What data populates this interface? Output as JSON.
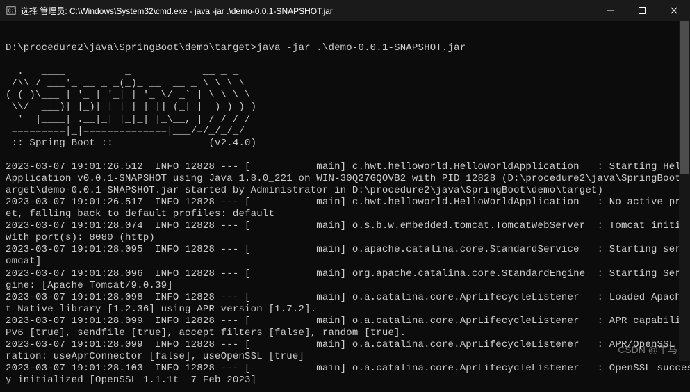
{
  "window": {
    "title": "选择 管理员: C:\\Windows\\System32\\cmd.exe - java  -jar .\\demo-0.0.1-SNAPSHOT.jar"
  },
  "terminal": {
    "prompt_line": "D:\\procedure2\\java\\SpringBoot\\demo\\target>java -jar .\\demo-0.0.1-SNAPSHOT.jar",
    "banner": "  .   ____          _            __ _ _\n /\\\\ / ___'_ __ _ _(_)_ __  __ _ \\ \\ \\ \\\n( ( )\\___ | '_ | '_| | '_ \\/ _` | \\ \\ \\ \\\n \\\\/  ___)| |_)| | | | | || (_| |  ) ) ) )\n  '  |____| .__|_| |_|_| |_\\__, | / / / /\n =========|_|==============|___/=/_/_/_/",
    "banner_footer": " :: Spring Boot ::                (v2.4.0)",
    "log_block": "2023-03-07 19:01:26.512  INFO 12828 --- [           main] c.hwt.helloworld.HelloWorldApplication   : Starting HelloWorld\nApplication v0.0.1-SNAPSHOT using Java 1.8.0_221 on WIN-30Q27GQOVB2 with PID 12828 (D:\\procedure2\\java\\SpringBoot\\demo\\t\narget\\demo-0.0.1-SNAPSHOT.jar started by Administrator in D:\\procedure2\\java\\SpringBoot\\demo\\target)\n2023-03-07 19:01:26.517  INFO 12828 --- [           main] c.hwt.helloworld.HelloWorldApplication   : No active profile s\net, falling back to default profiles: default\n2023-03-07 19:01:28.074  INFO 12828 --- [           main] o.s.b.w.embedded.tomcat.TomcatWebServer  : Tomcat initialized \nwith port(s): 8080 (http)\n2023-03-07 19:01:28.095  INFO 12828 --- [           main] o.apache.catalina.core.StandardService   : Starting service [T\nomcat]\n2023-03-07 19:01:28.096  INFO 12828 --- [           main] org.apache.catalina.core.StandardEngine  : Starting Servlet en\ngine: [Apache Tomcat/9.0.39]\n2023-03-07 19:01:28.098  INFO 12828 --- [           main] o.a.catalina.core.AprLifecycleListener   : Loaded Apache Tomca\nt Native library [1.2.36] using APR version [1.7.2].\n2023-03-07 19:01:28.099  INFO 12828 --- [           main] o.a.catalina.core.AprLifecycleListener   : APR capabilities: I\nPv6 [true], sendfile [true], accept filters [false], random [true].\n2023-03-07 19:01:28.099  INFO 12828 --- [           main] o.a.catalina.core.AprLifecycleListener   : APR/OpenSSL configu\nration: useAprConnector [false], useOpenSSL [true]\n2023-03-07 19:01:28.103  INFO 12828 --- [           main] o.a.catalina.core.AprLifecycleListener   : OpenSSL successfull\ny initialized [OpenSSL 1.1.1t  7 Feb 2023]"
  },
  "watermark": "CSDN @牛马"
}
